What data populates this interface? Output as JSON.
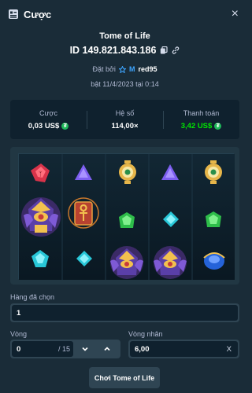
{
  "header": {
    "title": "Cược",
    "icon": "receipt-icon",
    "close_icon": "close-icon",
    "close_label": "×"
  },
  "game": {
    "name": "Tome of Life",
    "bet_id": "ID 149.821.843.186"
  },
  "placed": {
    "prefix": "Đặt bởi",
    "vip_letter": "M",
    "user": "red95",
    "timestamp": "bật 11/4/2023 tại 0:14"
  },
  "stats": [
    {
      "label": "Cược",
      "value": "0,03 US$",
      "has_coin": true,
      "color": "#ffffff"
    },
    {
      "label": "Hệ số",
      "value": "114,00×",
      "has_coin": false,
      "color": "#ffffff"
    },
    {
      "label": "Thanh toán",
      "value": "3,42 US$",
      "has_coin": true,
      "color": "#00e701"
    }
  ],
  "reels": {
    "symbols": [
      [
        "red-gem",
        "pharaoh-big",
        "cyan-gem"
      ],
      [
        "purple-gem",
        "ankh-tablet",
        "cyan-gem"
      ],
      [
        "eye-orb",
        "green-gem",
        "pharaoh-medium"
      ],
      [
        "purple-gem",
        "cyan-gem",
        "pharaoh-medium"
      ],
      [
        "eye-orb",
        "green-gem",
        "blue-orb"
      ]
    ]
  },
  "form": {
    "selected_rows_label": "Hàng đã chọn",
    "selected_rows_value": "1",
    "rounds_label": "Vòng",
    "rounds_value": "0",
    "rounds_total": "/ 15",
    "multiplier_label": "Vòng nhân",
    "multiplier_value": "6,00",
    "multiplier_suffix": "X"
  },
  "play_button": "Chơi Tome of Life",
  "colors": {
    "bg": "#1a2c38",
    "panel": "#0f212e",
    "input": "#2f4553",
    "payout": "#00e701",
    "muted": "#b1bad3"
  }
}
